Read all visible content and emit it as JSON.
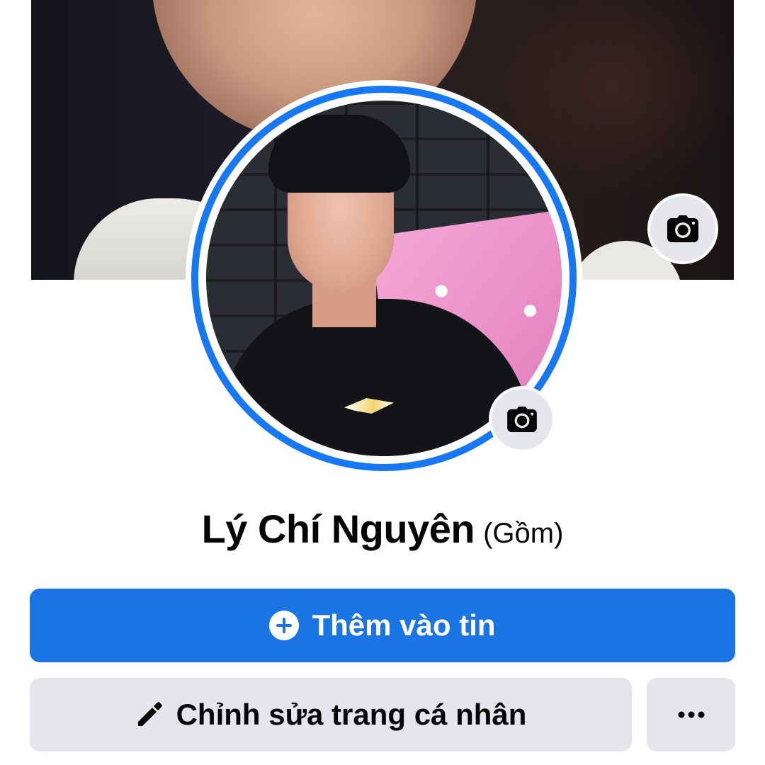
{
  "profile": {
    "name": "Lý Chí Nguyên",
    "alternate_name": "(Gồm)"
  },
  "actions": {
    "add_to_story_label": "Thêm vào tin",
    "edit_profile_label": "Chỉnh sửa trang cá nhân",
    "more_label": "..."
  },
  "icons": {
    "cover_camera": "camera-icon",
    "avatar_camera": "camera-icon",
    "add": "plus-circle-icon",
    "edit": "pencil-icon",
    "more": "more-horizontal-icon"
  },
  "colors": {
    "primary_button": "#1b74e4",
    "avatar_ring": "#1877f2",
    "secondary_button": "#e4e6eb",
    "text": "#050505"
  }
}
